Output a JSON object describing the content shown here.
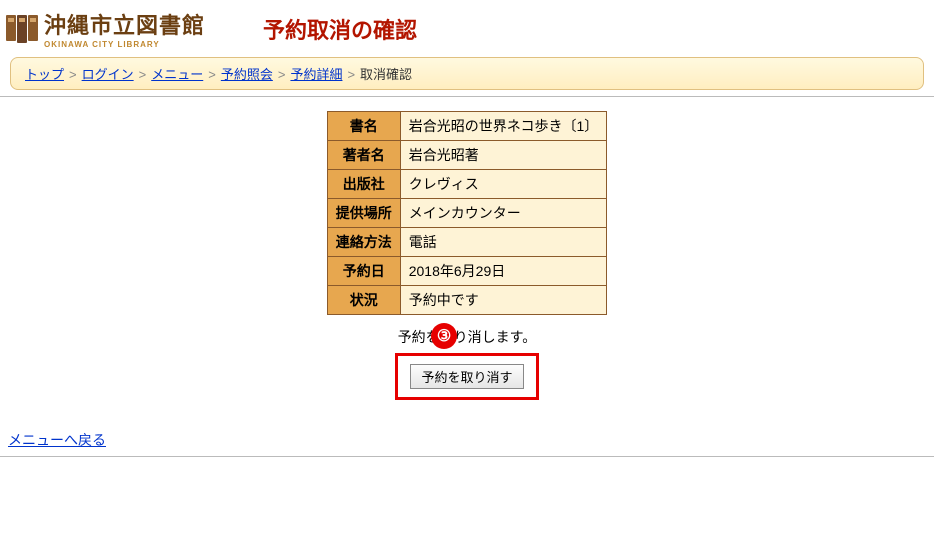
{
  "header": {
    "logo_main": "沖縄市立図書館",
    "logo_sub": "OKINAWA CITY LIBRARY",
    "page_title": "予約取消の確認"
  },
  "breadcrumb": {
    "items": [
      {
        "label": "トップ",
        "link": true
      },
      {
        "label": "ログイン",
        "link": true
      },
      {
        "label": "メニュー",
        "link": true
      },
      {
        "label": "予約照会",
        "link": true
      },
      {
        "label": "予約詳細",
        "link": true
      },
      {
        "label": "取消確認",
        "link": false
      }
    ]
  },
  "table": {
    "rows": [
      {
        "label": "書名",
        "value": "岩合光昭の世界ネコ歩き〔1〕"
      },
      {
        "label": "著者名",
        "value": "岩合光昭著"
      },
      {
        "label": "出版社",
        "value": "クレヴィス"
      },
      {
        "label": "提供場所",
        "value": "メインカウンター"
      },
      {
        "label": "連絡方法",
        "value": "電話"
      },
      {
        "label": "予約日",
        "value": "2018年6月29日"
      },
      {
        "label": "状況",
        "value": "予約中です"
      }
    ]
  },
  "confirm": {
    "text": "予約を取り消します。",
    "button_label": "予約を取り消す",
    "badge": "③"
  },
  "back_link": "メニューへ戻る"
}
